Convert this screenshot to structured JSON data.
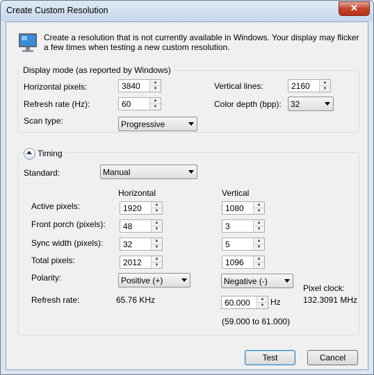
{
  "window": {
    "title": "Create Custom Resolution",
    "close_label": "✕"
  },
  "intro_text": "Create a resolution that is not currently available in Windows. Your display may flicker a few times when testing a new custom resolution.",
  "display_mode": {
    "group_label": "Display mode (as reported by Windows)",
    "horizontal_pixels_label": "Horizontal pixels:",
    "horizontal_pixels": "3840",
    "vertical_lines_label": "Vertical lines:",
    "vertical_lines": "2160",
    "refresh_rate_label": "Refresh rate (Hz):",
    "refresh_rate": "60",
    "color_depth_label": "Color depth (bpp):",
    "color_depth": "32",
    "scan_type_label": "Scan type:",
    "scan_type": "Progressive"
  },
  "timing": {
    "group_label": "Timing",
    "standard_label": "Standard:",
    "standard": "Manual",
    "horizontal_header": "Horizontal",
    "vertical_header": "Vertical",
    "active_pixels_label": "Active pixels:",
    "active_h": "1920",
    "active_v": "1080",
    "front_porch_label": "Front porch (pixels):",
    "front_h": "48",
    "front_v": "3",
    "sync_width_label": "Sync width (pixels):",
    "sync_h": "32",
    "sync_v": "5",
    "total_pixels_label": "Total pixels:",
    "total_h": "2012",
    "total_v": "1096",
    "polarity_label": "Polarity:",
    "polarity_h": "Positive (+)",
    "polarity_v": "Negative (-)",
    "refresh_rate_label": "Refresh rate:",
    "h_refresh": "65.76 KHz",
    "v_refresh": "60.000",
    "v_refresh_unit": "Hz",
    "refresh_range": "(59.000 to 61.000)",
    "pixel_clock_label": "Pixel clock:",
    "pixel_clock": "132.3091 MHz"
  },
  "buttons": {
    "test": "Test",
    "cancel": "Cancel"
  }
}
